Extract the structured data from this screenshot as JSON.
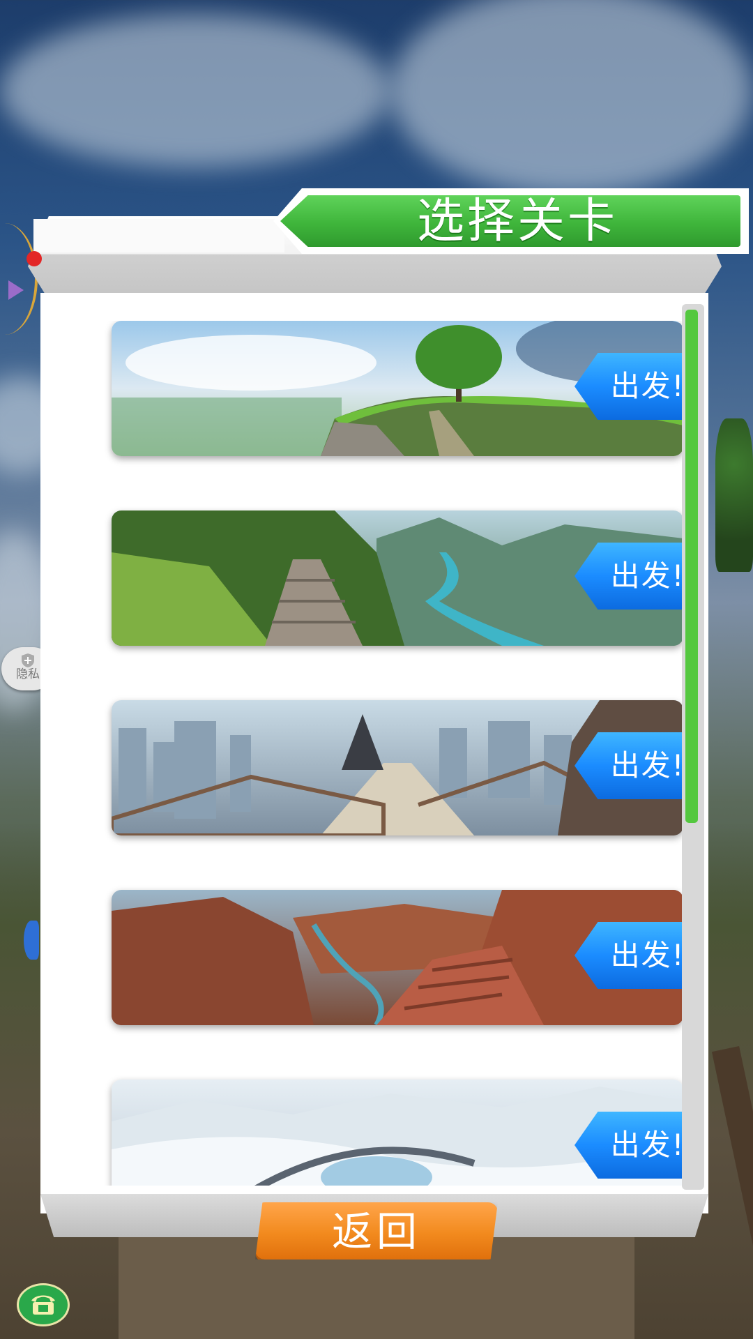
{
  "panel": {
    "title": "选择关卡",
    "back_label": "返回"
  },
  "levels": [
    {
      "go_label": "出发!",
      "scene": "cliff-tree"
    },
    {
      "go_label": "出发!",
      "scene": "mountain-river"
    },
    {
      "go_label": "出发!",
      "scene": "city-stairs"
    },
    {
      "go_label": "出发!",
      "scene": "canyon-stairs"
    },
    {
      "go_label": "出发!",
      "scene": "snow-bridge"
    }
  ],
  "side": {
    "privacy_label": "隐私"
  },
  "colors": {
    "title_green": "#3fb53b",
    "go_blue": "#1b8cff",
    "back_orange": "#f28a1e",
    "scroll_green": "#54c83f"
  }
}
